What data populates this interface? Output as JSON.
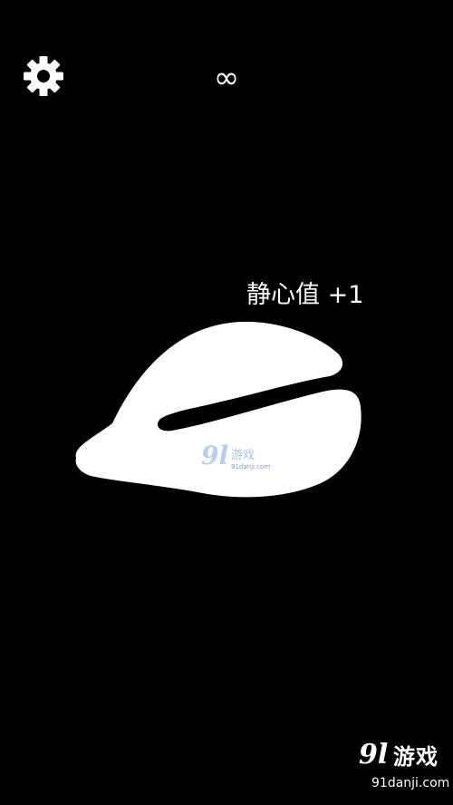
{
  "hud": {
    "settings_icon": "gear-icon",
    "counter_symbol": "∞"
  },
  "popup": {
    "reward_text": "静心值 +1"
  },
  "object": {
    "name": "wooden-fish",
    "color": "#ffffff"
  },
  "watermark_center": {
    "number": "9l",
    "text": "游戏",
    "url": "91danji.com"
  },
  "watermark_corner": {
    "number": "9l",
    "text": "游戏",
    "url": "91danji.com"
  },
  "colors": {
    "background": "#000000",
    "foreground": "#ffffff",
    "watermark_blue": "#a9c6f0"
  }
}
